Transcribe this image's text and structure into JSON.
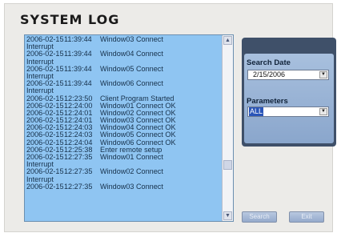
{
  "title": "SYSTEM LOG",
  "log_entries": [
    {
      "date": "2006-02-15",
      "time": "11:39:44",
      "message": "Window03  Connect",
      "continuation": "Interrupt"
    },
    {
      "date": "2006-02-15",
      "time": "11:39:44",
      "message": "Window04  Connect",
      "continuation": "Interrupt"
    },
    {
      "date": "2006-02-15",
      "time": "11:39:44",
      "message": "Window05  Connect",
      "continuation": "Interrupt"
    },
    {
      "date": "2006-02-15",
      "time": "11:39:44",
      "message": "Window06  Connect",
      "continuation": "Interrupt"
    },
    {
      "date": "2006-02-15",
      "time": "12:23:50",
      "message": "Client Program Started",
      "continuation": ""
    },
    {
      "date": "2006-02-15",
      "time": "12:24:00",
      "message": "Window01  Connect OK",
      "continuation": ""
    },
    {
      "date": "2006-02-15",
      "time": "12:24:01",
      "message": "Window02  Connect OK",
      "continuation": ""
    },
    {
      "date": "2006-02-15",
      "time": "12:24:01",
      "message": "Window03  Connect OK",
      "continuation": ""
    },
    {
      "date": "2006-02-15",
      "time": "12:24:03",
      "message": "Window04  Connect OK",
      "continuation": ""
    },
    {
      "date": "2006-02-15",
      "time": "12:24:03",
      "message": "Window05  Connect OK",
      "continuation": ""
    },
    {
      "date": "2006-02-15",
      "time": "12:24:04",
      "message": "Window06  Connect OK",
      "continuation": ""
    },
    {
      "date": "2006-02-15",
      "time": "12:25:38",
      "message": "Enter remote setup",
      "continuation": ""
    },
    {
      "date": "2006-02-15",
      "time": "12:27:35",
      "message": "Window01  Connect",
      "continuation": "Interrupt"
    },
    {
      "date": "2006-02-15",
      "time": "12:27:35",
      "message": "Window02  Connect",
      "continuation": "Interrupt"
    },
    {
      "date": "2006-02-15",
      "time": "12:27:35",
      "message": "Window03  Connect",
      "continuation": ""
    }
  ],
  "search": {
    "date_label": "Search Date",
    "date_value": "2/15/2006",
    "parameters_label": "Parameters",
    "parameters_value": "ALL"
  },
  "buttons": {
    "search_label": "Search",
    "exit_label": "Exit"
  },
  "icons": {
    "scroll_up": "scroll-up-arrow-icon",
    "scroll_down": "scroll-down-arrow-icon",
    "dropdown": "chevron-down-icon"
  },
  "colors": {
    "log_background": "#8fc5f2",
    "panel_dark": "#3f5069",
    "panel_light": "#a8c0de"
  }
}
